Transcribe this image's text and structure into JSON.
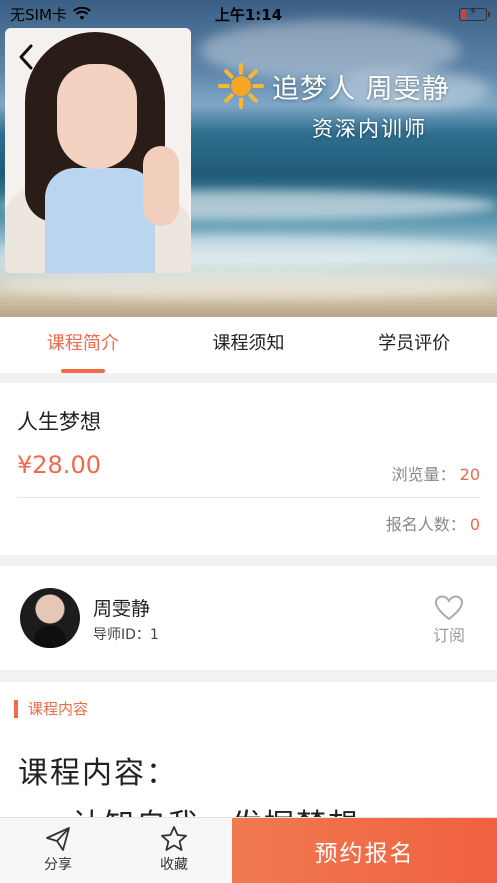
{
  "status_bar": {
    "carrier": "无SIM卡",
    "time": "上午1:14",
    "battery_icon": "battery-low-charging-icon"
  },
  "hero": {
    "title": "追梦人 周雯静",
    "subtitle": "资深内训师"
  },
  "tabs": [
    {
      "label": "课程简介",
      "active": true
    },
    {
      "label": "课程须知",
      "active": false
    },
    {
      "label": "学员评价",
      "active": false
    }
  ],
  "course": {
    "name": "人生梦想",
    "price": "¥28.00",
    "views_label": "浏览量：",
    "views": "20",
    "signups_label": "报名人数：",
    "signups": "0"
  },
  "tutor": {
    "name": "周雯静",
    "id_label": "导师ID：1",
    "subscribe_label": "订阅"
  },
  "content": {
    "section_label": "课程内容",
    "heading": "课程内容：",
    "line1": "认知自我，发掘梦想"
  },
  "bottom_bar": {
    "share_label": "分享",
    "favorite_label": "收藏",
    "cta_label": "预约报名"
  },
  "colors": {
    "accent": "#f26a4a"
  }
}
